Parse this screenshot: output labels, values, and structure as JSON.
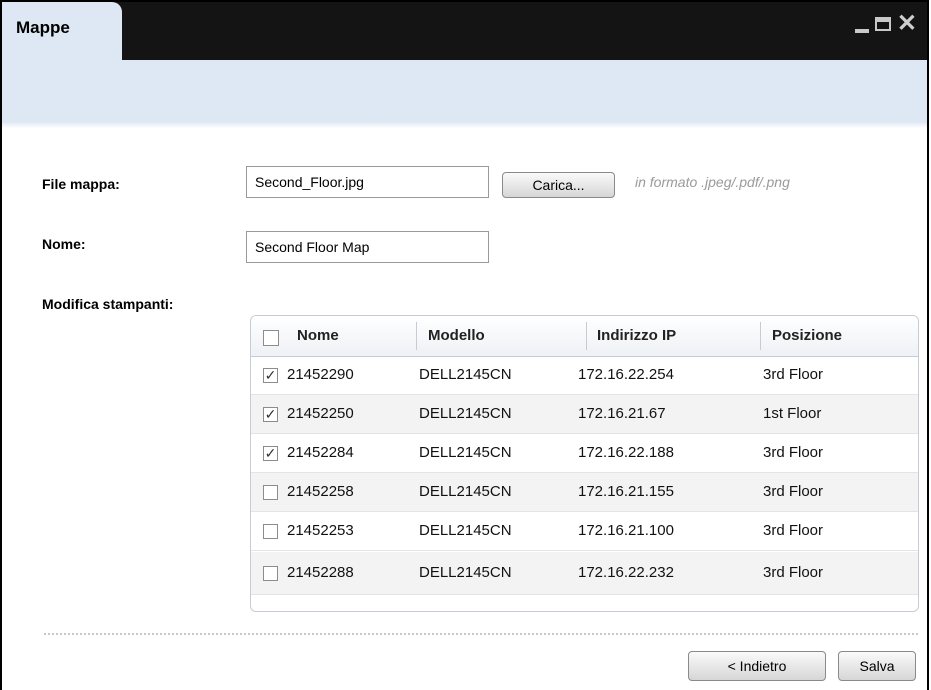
{
  "window": {
    "title": "Mappe",
    "controls": {
      "minimize_icon": "minimize-icon",
      "maximize_icon": "maximize-icon",
      "close_icon": "close-icon",
      "close_glyph": "✕"
    }
  },
  "form": {
    "file_label": "File mappa:",
    "file_value": "Second_Floor.jpg",
    "upload_button": "Carica...",
    "format_hint": "in formato .jpeg/.pdf/.png",
    "name_label": "Nome:",
    "name_value": "Second Floor Map",
    "printers_label": "Modifica stampanti:"
  },
  "table": {
    "columns": [
      "Nome",
      "Modello",
      "Indirizzo IP",
      "Posizione"
    ],
    "rows": [
      {
        "checked": true,
        "check_glyph": "✓",
        "nome": "21452290",
        "modello": "DELL2145CN",
        "ip": "172.16.22.254",
        "posizione": "3rd Floor"
      },
      {
        "checked": true,
        "check_glyph": "✓",
        "nome": "21452250",
        "modello": "DELL2145CN",
        "ip": "172.16.21.67",
        "posizione": "1st Floor"
      },
      {
        "checked": true,
        "check_glyph": "✓",
        "nome": "21452284",
        "modello": "DELL2145CN",
        "ip": "172.16.22.188",
        "posizione": "3rd Floor"
      },
      {
        "checked": false,
        "check_glyph": "",
        "nome": "21452258",
        "modello": "DELL2145CN",
        "ip": "172.16.21.155",
        "posizione": "3rd Floor"
      },
      {
        "checked": false,
        "check_glyph": "",
        "nome": "21452253",
        "modello": "DELL2145CN",
        "ip": "172.16.21.100",
        "posizione": "3rd Floor"
      },
      {
        "checked": false,
        "check_glyph": "",
        "nome": "21452288",
        "modello": "DELL2145CN",
        "ip": "172.16.22.232",
        "posizione": "3rd Floor"
      }
    ]
  },
  "footer": {
    "back_button": "< Indietro",
    "save_button": "Salva"
  },
  "colors": {
    "header_band": "#dde8f4",
    "titlebar": "#141414"
  }
}
